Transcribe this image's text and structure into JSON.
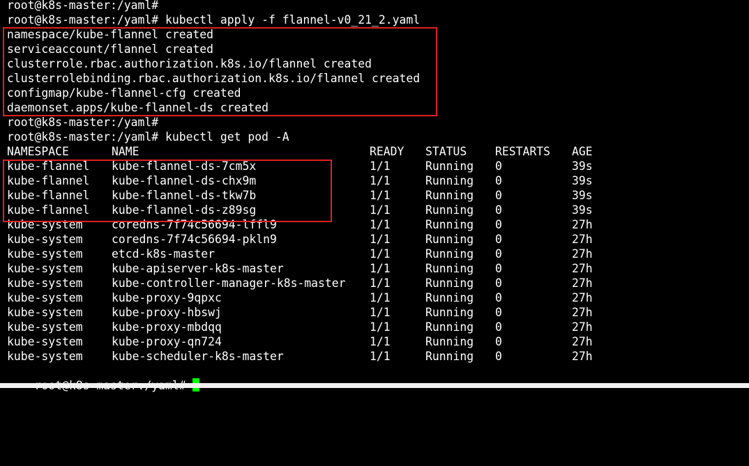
{
  "terminal": {
    "prompt": "root@k8s-master:/yaml#",
    "colors": {
      "background": "#000000",
      "text": "#ffffff",
      "cursor": "#00ff00",
      "highlight": "#e02020"
    },
    "lines": {
      "l0": "root@k8s-master:/yaml#",
      "l1": "root@k8s-master:/yaml# kubectl apply -f flannel-v0_21_2.yaml",
      "l2": "namespace/kube-flannel created",
      "l3": "serviceaccount/flannel created",
      "l4": "clusterrole.rbac.authorization.k8s.io/flannel created",
      "l5": "clusterrolebinding.rbac.authorization.k8s.io/flannel created",
      "l6": "configmap/kube-flannel-cfg created",
      "l7": "daemonset.apps/kube-flannel-ds created",
      "l8": "root@k8s-master:/yaml#",
      "l9": "root@k8s-master:/yaml# kubectl get pod -A",
      "last_prompt": "root@k8s-master:/yaml# "
    },
    "pod_table": {
      "headers": {
        "namespace": "NAMESPACE",
        "name": "NAME",
        "ready": "READY",
        "status": "STATUS",
        "restarts": "RESTARTS",
        "age": "AGE"
      },
      "rows": [
        {
          "namespace": "kube-flannel",
          "name": "kube-flannel-ds-7cm5x",
          "ready": "1/1",
          "status": "Running",
          "restarts": "0",
          "age": "39s"
        },
        {
          "namespace": "kube-flannel",
          "name": "kube-flannel-ds-chx9m",
          "ready": "1/1",
          "status": "Running",
          "restarts": "0",
          "age": "39s"
        },
        {
          "namespace": "kube-flannel",
          "name": "kube-flannel-ds-tkw7b",
          "ready": "1/1",
          "status": "Running",
          "restarts": "0",
          "age": "39s"
        },
        {
          "namespace": "kube-flannel",
          "name": "kube-flannel-ds-z89sg",
          "ready": "1/1",
          "status": "Running",
          "restarts": "0",
          "age": "39s"
        },
        {
          "namespace": "kube-system",
          "name": "coredns-7f74c56694-lffl9",
          "ready": "1/1",
          "status": "Running",
          "restarts": "0",
          "age": "27h"
        },
        {
          "namespace": "kube-system",
          "name": "coredns-7f74c56694-pkln9",
          "ready": "1/1",
          "status": "Running",
          "restarts": "0",
          "age": "27h"
        },
        {
          "namespace": "kube-system",
          "name": "etcd-k8s-master",
          "ready": "1/1",
          "status": "Running",
          "restarts": "0",
          "age": "27h"
        },
        {
          "namespace": "kube-system",
          "name": "kube-apiserver-k8s-master",
          "ready": "1/1",
          "status": "Running",
          "restarts": "0",
          "age": "27h"
        },
        {
          "namespace": "kube-system",
          "name": "kube-controller-manager-k8s-master",
          "ready": "1/1",
          "status": "Running",
          "restarts": "0",
          "age": "27h"
        },
        {
          "namespace": "kube-system",
          "name": "kube-proxy-9qpxc",
          "ready": "1/1",
          "status": "Running",
          "restarts": "0",
          "age": "27h"
        },
        {
          "namespace": "kube-system",
          "name": "kube-proxy-hbswj",
          "ready": "1/1",
          "status": "Running",
          "restarts": "0",
          "age": "27h"
        },
        {
          "namespace": "kube-system",
          "name": "kube-proxy-mbdqq",
          "ready": "1/1",
          "status": "Running",
          "restarts": "0",
          "age": "27h"
        },
        {
          "namespace": "kube-system",
          "name": "kube-proxy-qn724",
          "ready": "1/1",
          "status": "Running",
          "restarts": "0",
          "age": "27h"
        },
        {
          "namespace": "kube-system",
          "name": "kube-scheduler-k8s-master",
          "ready": "1/1",
          "status": "Running",
          "restarts": "0",
          "age": "27h"
        }
      ]
    }
  }
}
